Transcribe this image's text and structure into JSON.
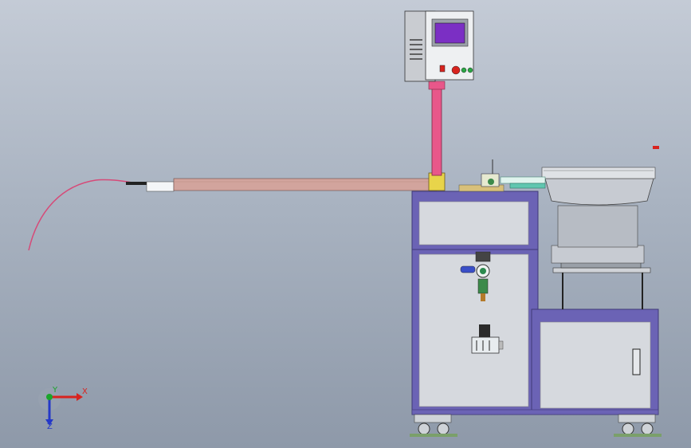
{
  "app": {
    "title": ""
  },
  "view": {
    "background_top": "#c4cbd6",
    "background_bottom": "#8e99a9"
  },
  "colors": {
    "cabinet_frame": "#6b63b5",
    "cabinet_panel": "#d6d9de",
    "cable": "#d64a78",
    "feed_rail": "#d2a49d",
    "pillar": "#e8578a",
    "screen": "#7b2fc4",
    "bowl": "#c7cbd2",
    "axis_x": "#d8231e",
    "axis_y": "#1aa52b",
    "axis_z": "#2438c8"
  },
  "icons": {
    "control_box": "control-panel-icon",
    "air_filter": "air-filter-regulator-icon",
    "solenoid": "solenoid-valve-icon",
    "caster": "caster-wheel-icon"
  },
  "triad": {
    "x_label": "X",
    "y_label": "Y",
    "z_label": "Z"
  }
}
